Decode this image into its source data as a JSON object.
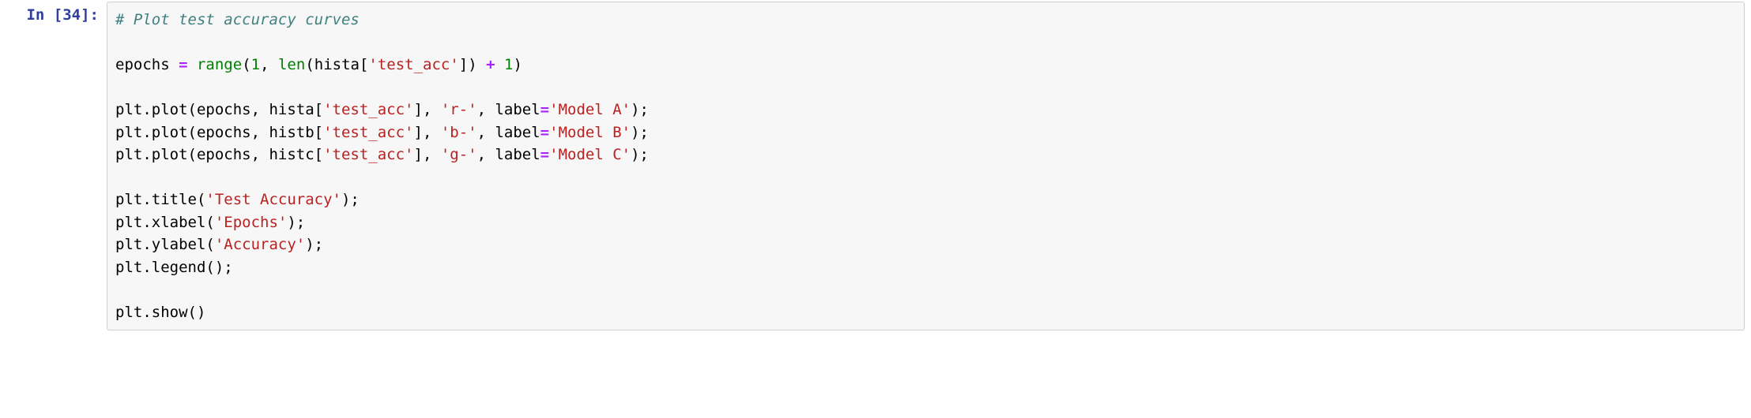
{
  "prompt": {
    "label": "In",
    "sep1": " [",
    "num": "34",
    "sep2": "]:"
  },
  "code": {
    "l1": {
      "a": "# Plot test accuracy curves"
    },
    "l2": {
      "a": ""
    },
    "l3": {
      "a": "epochs ",
      "b": "=",
      "c": " ",
      "d": "range",
      "e": "(",
      "f": "1",
      "g": ", ",
      "h": "len",
      "i": "(hista[",
      "j": "'test_acc'",
      "k": "]) ",
      "l": "+",
      "m": " ",
      "n": "1",
      "o": ")"
    },
    "l4": {
      "a": ""
    },
    "l5": {
      "a": "plt.plot(epochs, hista[",
      "b": "'test_acc'",
      "c": "], ",
      "d": "'r-'",
      "e": ", label",
      "f": "=",
      "g": "'Model A'",
      "h": ");"
    },
    "l6": {
      "a": "plt.plot(epochs, histb[",
      "b": "'test_acc'",
      "c": "], ",
      "d": "'b-'",
      "e": ", label",
      "f": "=",
      "g": "'Model B'",
      "h": ");"
    },
    "l7": {
      "a": "plt.plot(epochs, histc[",
      "b": "'test_acc'",
      "c": "], ",
      "d": "'g-'",
      "e": ", label",
      "f": "=",
      "g": "'Model C'",
      "h": ");"
    },
    "l8": {
      "a": ""
    },
    "l9": {
      "a": "plt.title(",
      "b": "'Test Accuracy'",
      "c": ");"
    },
    "l10": {
      "a": "plt.xlabel(",
      "b": "'Epochs'",
      "c": ");"
    },
    "l11": {
      "a": "plt.ylabel(",
      "b": "'Accuracy'",
      "c": ");"
    },
    "l12": {
      "a": "plt.legend();"
    },
    "l13": {
      "a": ""
    },
    "l14": {
      "a": "plt.show()"
    }
  }
}
